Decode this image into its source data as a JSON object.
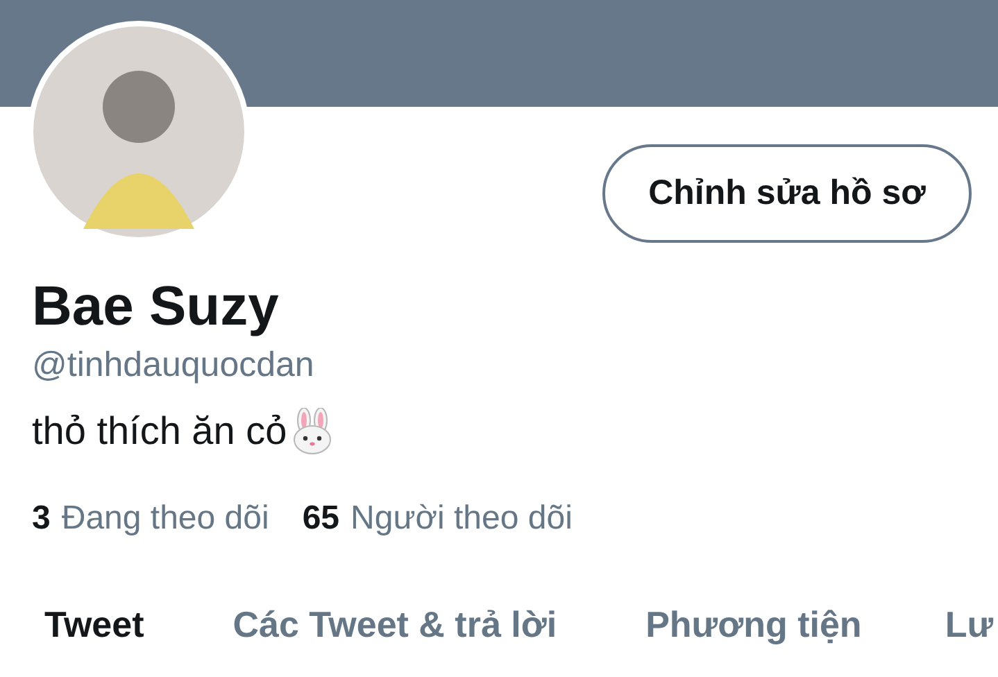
{
  "profile": {
    "edit_button": "Chỉnh sửa hồ sơ",
    "name": "Bae Suzy",
    "handle": "@tinhdauquocdan",
    "bio": "thỏ thích ăn cỏ"
  },
  "stats": [
    {
      "count": "3",
      "label": "Đang theo dõi"
    },
    {
      "count": "65",
      "label": "Người theo dõi"
    }
  ],
  "tabs": [
    {
      "label": "Tweet",
      "selected": true
    },
    {
      "label": "Các Tweet & trả lời",
      "selected": false
    },
    {
      "label": "Phương tiện",
      "selected": false
    },
    {
      "label": "Lư",
      "selected": false
    }
  ]
}
